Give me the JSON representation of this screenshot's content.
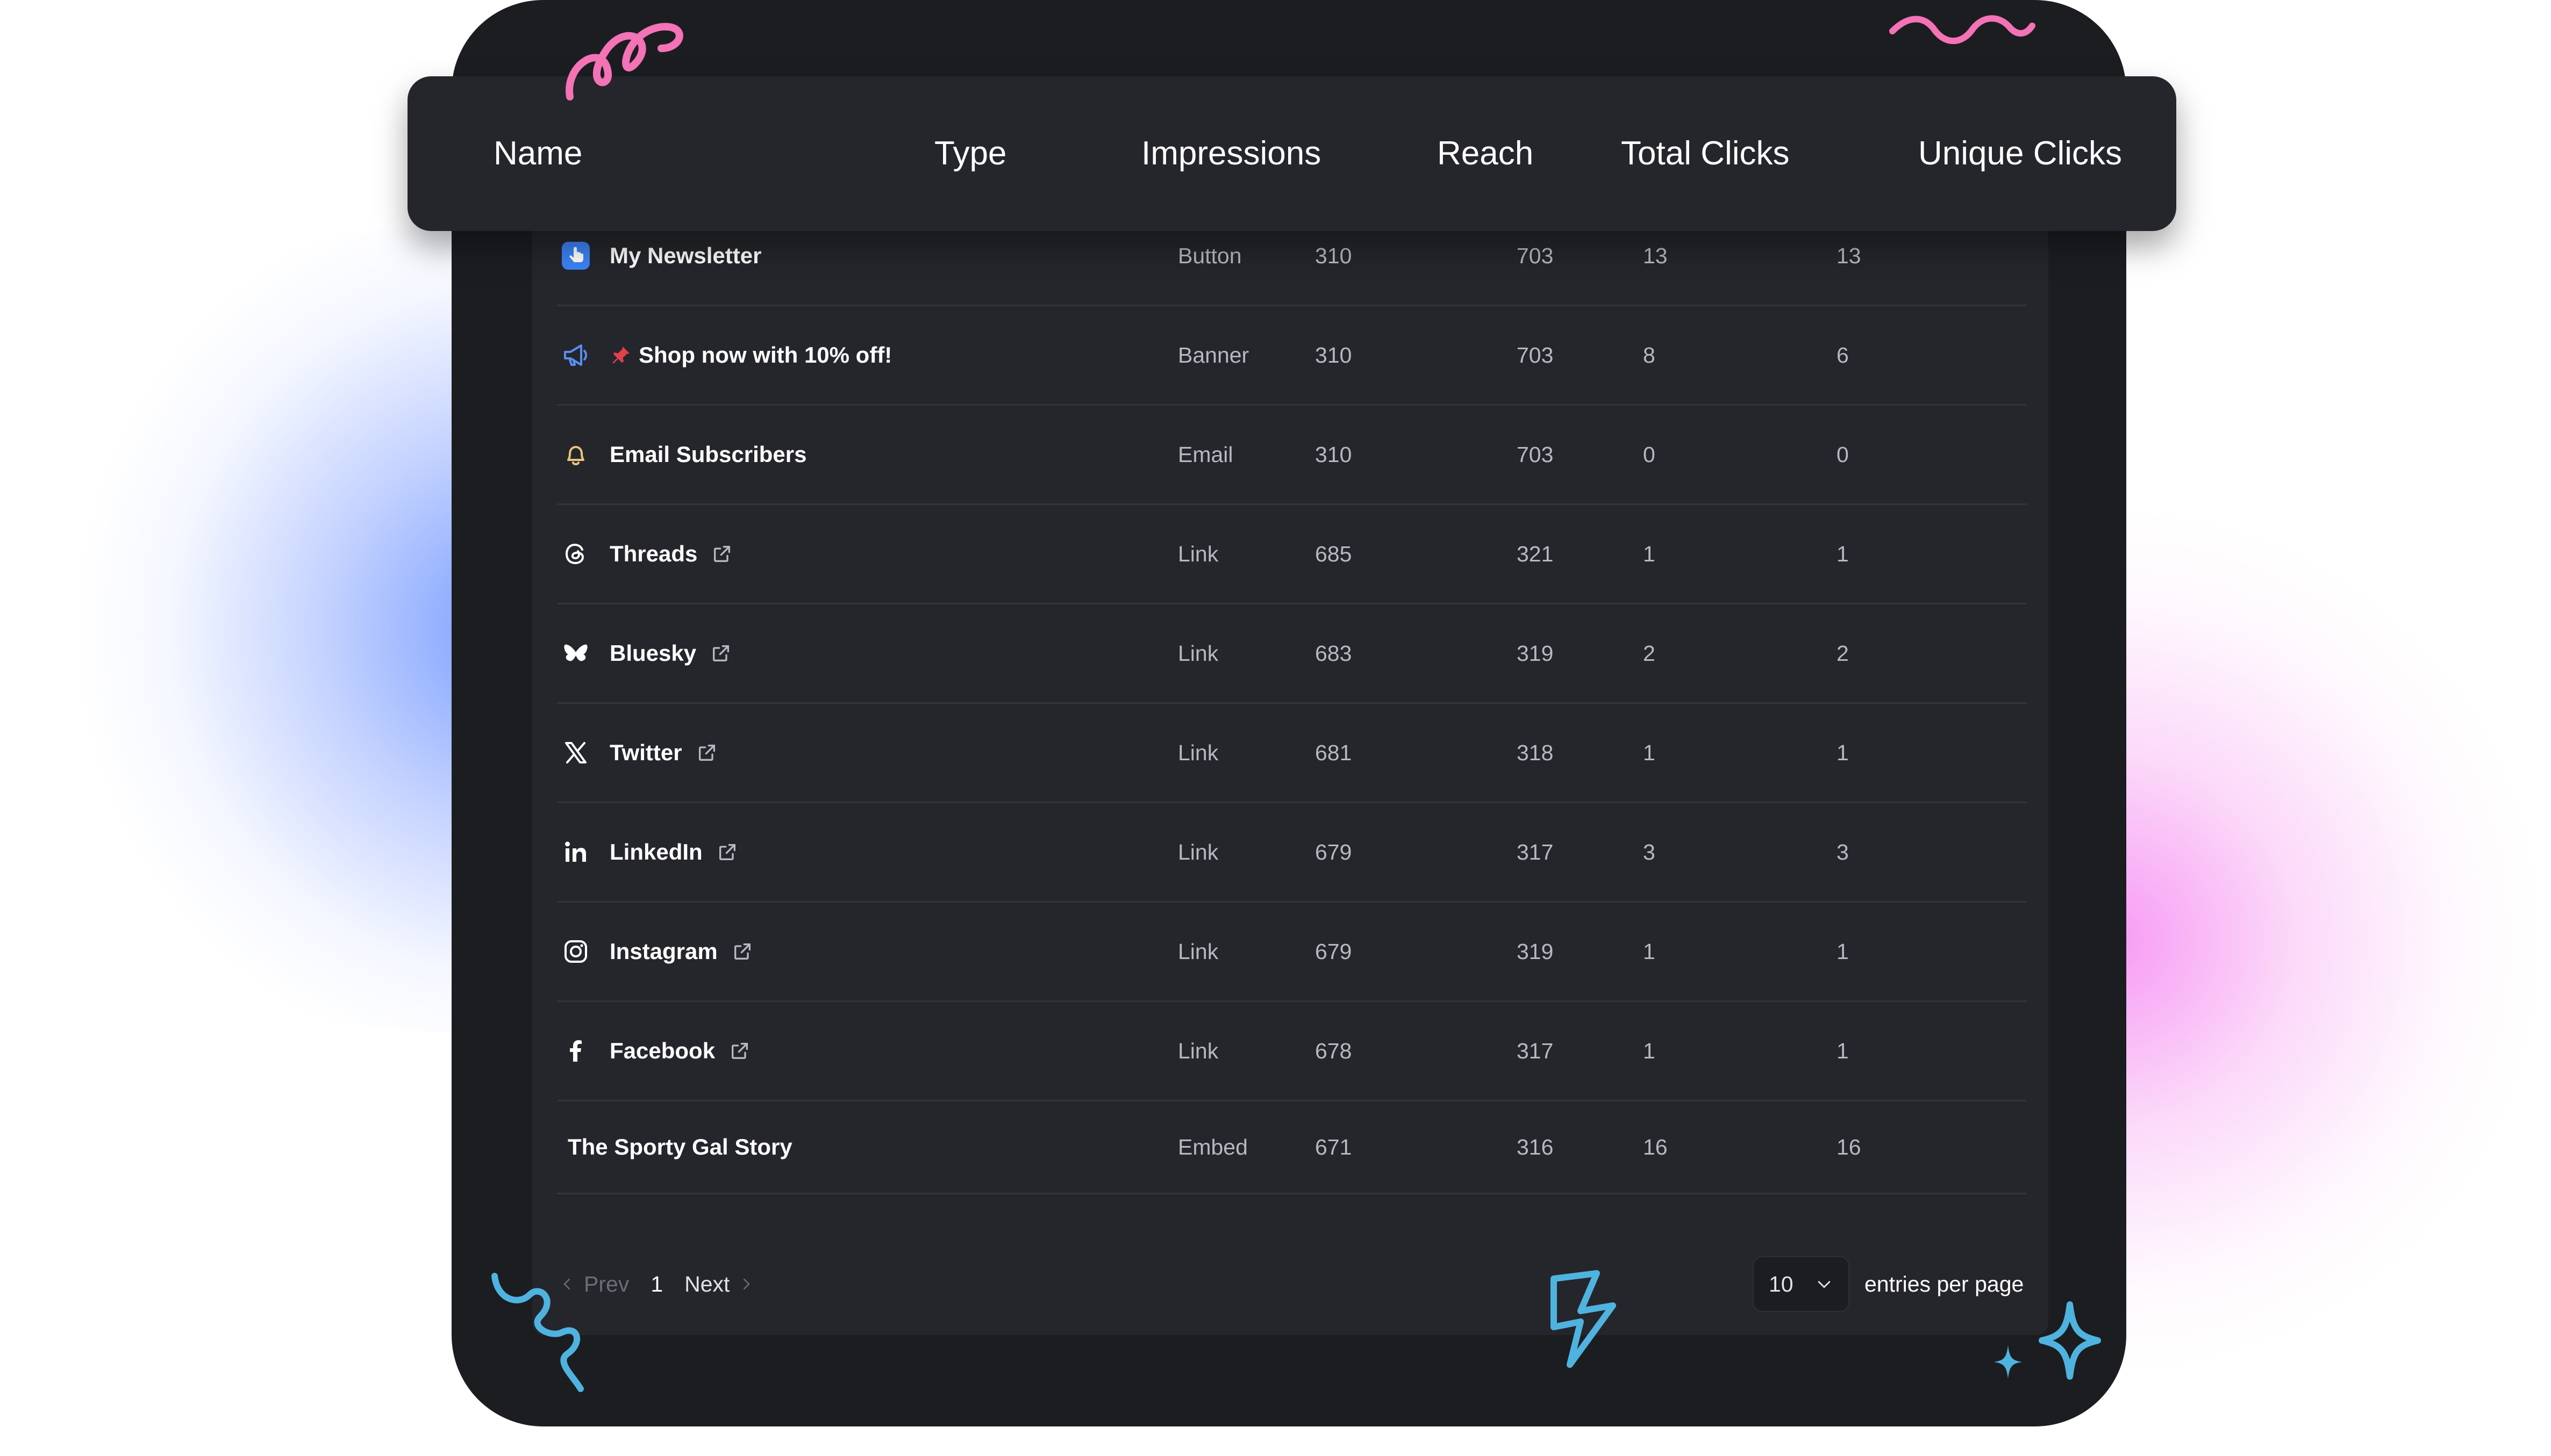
{
  "header": {
    "columns": [
      "Name",
      "Type",
      "Impressions",
      "Reach",
      "Total Clicks",
      "Unique Clicks"
    ]
  },
  "rows": [
    {
      "icon": "pointer-hand-icon",
      "name": "My Newsletter",
      "type": "Button",
      "impressions": "310",
      "reach": "703",
      "total": "13",
      "unique": "13",
      "external": false
    },
    {
      "icon": "megaphone-icon",
      "prefix": "pushpin-icon",
      "name": "Shop now with 10% off!",
      "type": "Banner",
      "impressions": "310",
      "reach": "703",
      "total": "8",
      "unique": "6",
      "external": false
    },
    {
      "icon": "bell-icon",
      "name": "Email Subscribers",
      "type": "Email",
      "impressions": "310",
      "reach": "703",
      "total": "0",
      "unique": "0",
      "external": false
    },
    {
      "icon": "threads-icon",
      "name": "Threads",
      "type": "Link",
      "impressions": "685",
      "reach": "321",
      "total": "1",
      "unique": "1",
      "external": true
    },
    {
      "icon": "bluesky-icon",
      "name": "Bluesky",
      "type": "Link",
      "impressions": "683",
      "reach": "319",
      "total": "2",
      "unique": "2",
      "external": true
    },
    {
      "icon": "x-twitter-icon",
      "name": "Twitter",
      "type": "Link",
      "impressions": "681",
      "reach": "318",
      "total": "1",
      "unique": "1",
      "external": true
    },
    {
      "icon": "linkedin-icon",
      "name": "LinkedIn",
      "type": "Link",
      "impressions": "679",
      "reach": "317",
      "total": "3",
      "unique": "3",
      "external": true
    },
    {
      "icon": "instagram-icon",
      "name": "Instagram",
      "type": "Link",
      "impressions": "679",
      "reach": "319",
      "total": "1",
      "unique": "1",
      "external": true
    },
    {
      "icon": "facebook-icon",
      "name": "Facebook",
      "type": "Link",
      "impressions": "678",
      "reach": "317",
      "total": "1",
      "unique": "1",
      "external": true
    },
    {
      "icon": "",
      "name": "The Sporty Gal Story",
      "type": "Embed",
      "impressions": "671",
      "reach": "316",
      "total": "16",
      "unique": "16",
      "external": false
    }
  ],
  "pagination": {
    "prev_label": "Prev",
    "page": "1",
    "next_label": "Next",
    "per_page_value": "10",
    "per_page_label": "entries per page"
  },
  "colors": {
    "device_bg": "#1c1d21",
    "panel_bg": "#25262b",
    "accent_blue": "#3b82f6",
    "deco_pink": "#f472b6",
    "deco_cyan": "#4fb3e0"
  }
}
